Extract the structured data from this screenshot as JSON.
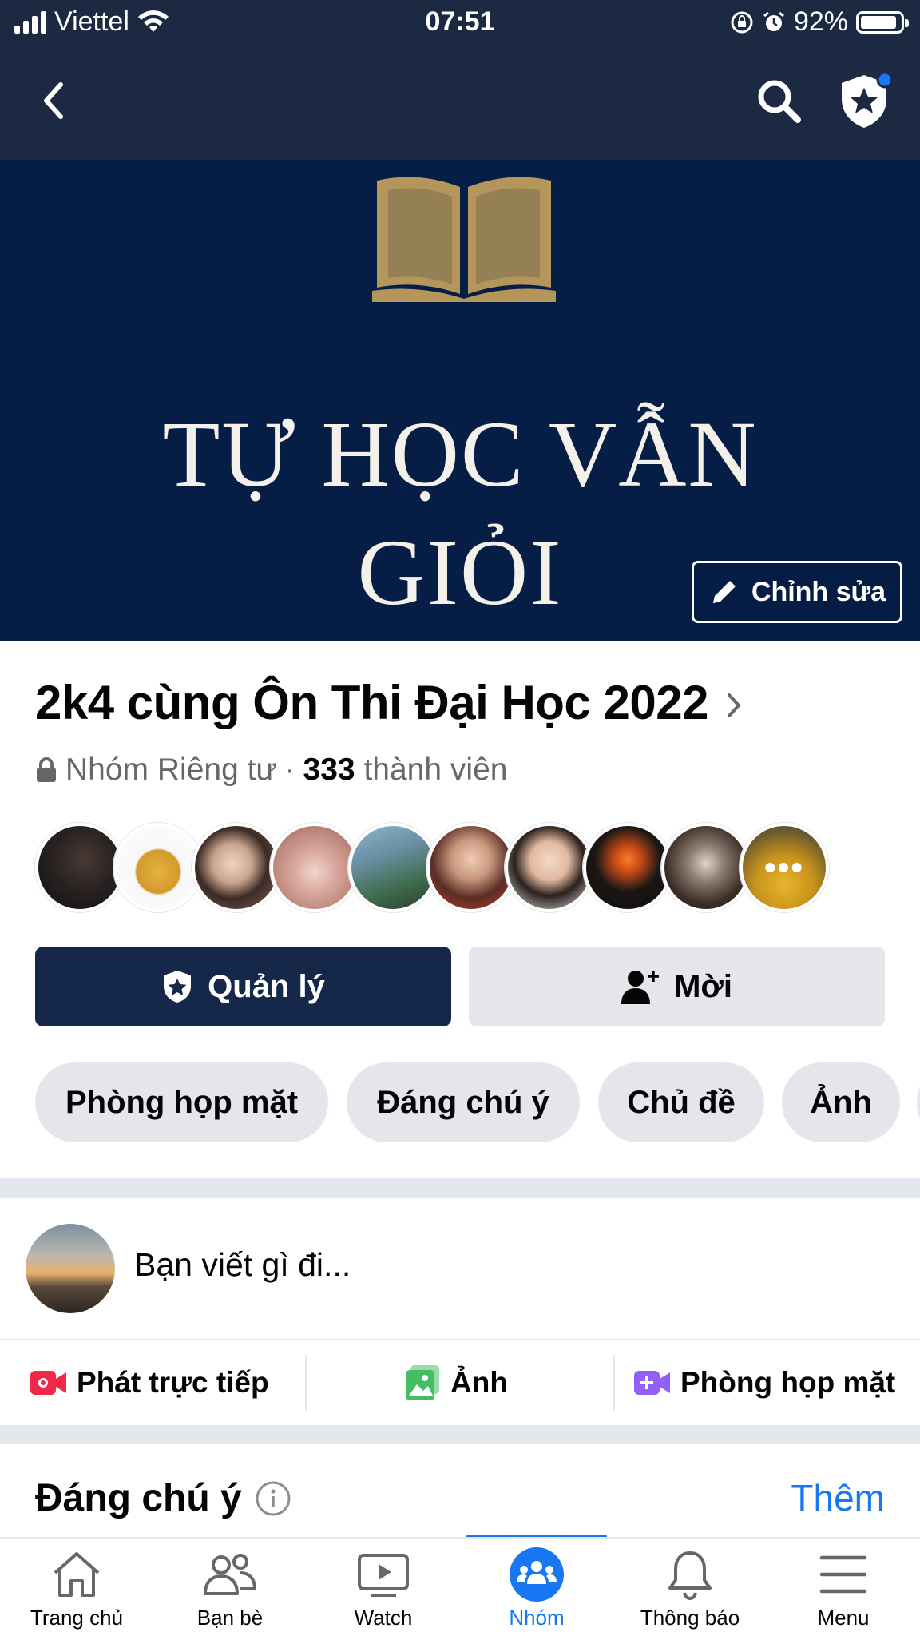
{
  "status_bar": {
    "carrier": "Viettel",
    "time": "07:51",
    "battery": "92%",
    "battery_level": 0.92
  },
  "nav": {
    "back_icon": "chevron-left-icon",
    "search_icon": "search-icon",
    "admin_icon": "shield-star-icon"
  },
  "cover": {
    "title_line1": "TỰ HỌC VẪN",
    "title_line2": "GIỎI",
    "edit_label": "Chỉnh sửa",
    "background": "#061d46",
    "book_color": "#b5965a"
  },
  "group": {
    "name": "2k4 cùng Ôn Thi Đại Học 2022",
    "privacy": "Nhóm Riêng tư",
    "separator": "·",
    "member_count": "333",
    "member_suffix": "thành viên"
  },
  "actions": {
    "manage_label": "Quản lý",
    "invite_label": "Mời"
  },
  "tabs": [
    "Phòng họp mặt",
    "Đáng chú ý",
    "Chủ đề",
    "Ảnh"
  ],
  "composer": {
    "placeholder": "Bạn viết gì đi..."
  },
  "post_actions": {
    "live": "Phát trực tiếp",
    "photo": "Ảnh",
    "room": "Phòng họp mặt"
  },
  "featured": {
    "title": "Đáng chú ý",
    "more": "Thêm"
  },
  "tabbar": {
    "home": "Trang chủ",
    "friends": "Bạn bè",
    "watch": "Watch",
    "groups": "Nhóm",
    "notifications": "Thông báo",
    "menu": "Menu"
  },
  "colors": {
    "header": "#1b2942",
    "primary_button": "#15284a",
    "accent": "#1877f2",
    "live_red": "#f02849",
    "photo_green": "#45bd62",
    "room_purple": "#9360f7"
  }
}
